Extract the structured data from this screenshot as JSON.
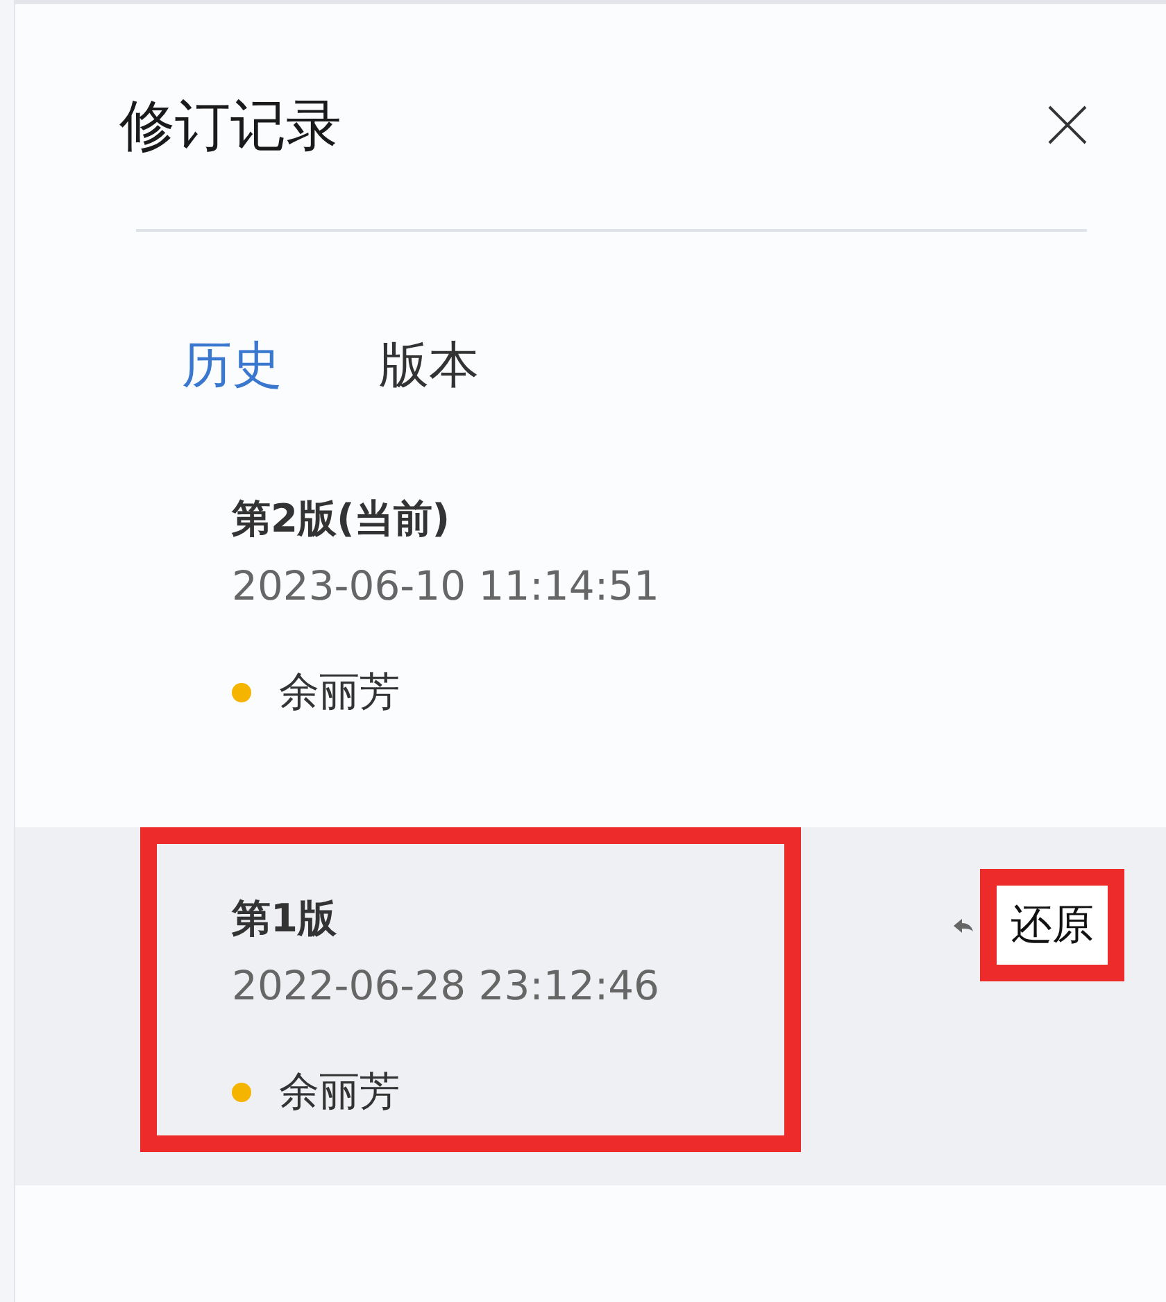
{
  "panel": {
    "title": "修订记录"
  },
  "tabs": [
    {
      "label": "历史",
      "selected": true
    },
    {
      "label": "版本",
      "selected": false
    }
  ],
  "versions": [
    {
      "name": "第2版(当前)",
      "time": "2023-06-10 11:14:51",
      "author": "余丽芳",
      "color": "#f5b400",
      "selected": false,
      "highlighted": false
    },
    {
      "name": "第1版",
      "time": "2022-06-28 23:12:46",
      "author": "余丽芳",
      "color": "#f5b400",
      "selected": true,
      "highlighted": true,
      "restore": {
        "label": "还原",
        "highlighted": true
      }
    }
  ]
}
